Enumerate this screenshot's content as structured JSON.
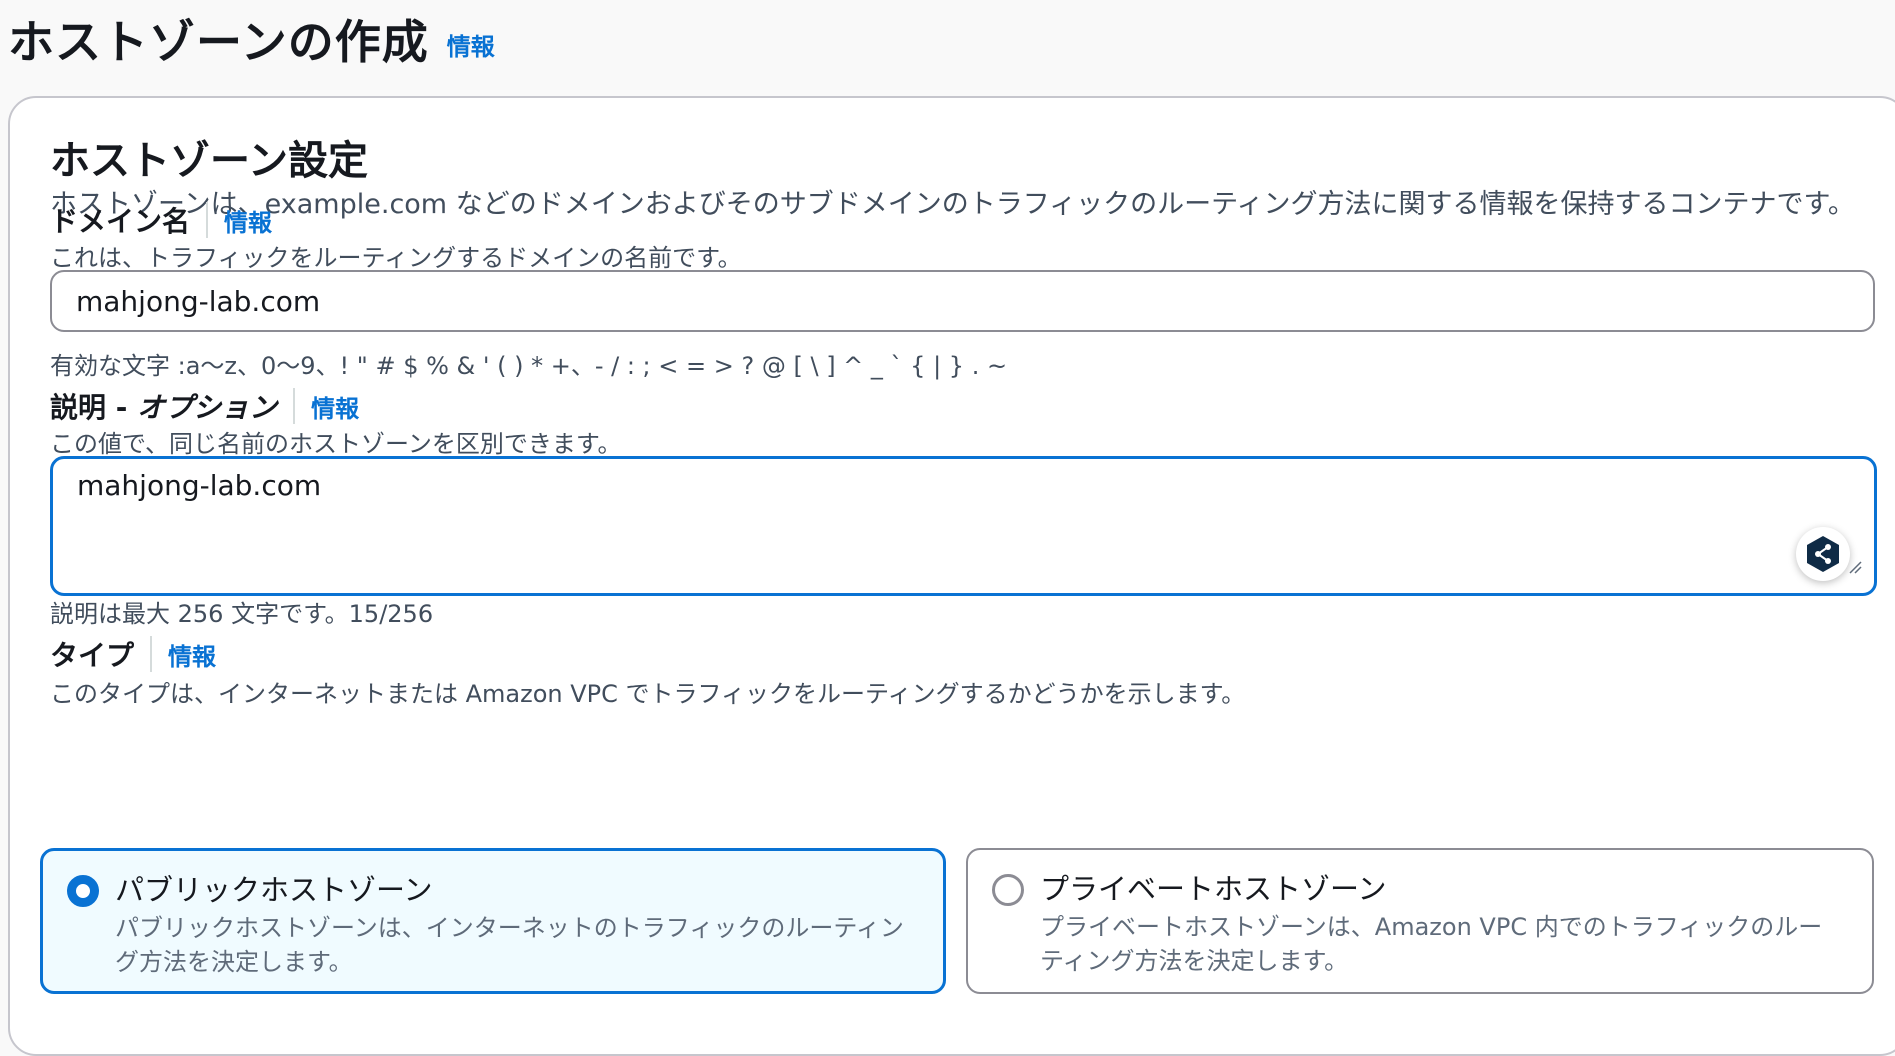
{
  "page": {
    "title": "ホストゾーンの作成",
    "info": "情報"
  },
  "section": {
    "title": "ホストゾーン設定",
    "description": "ホストゾーンは、example.com などのドメインおよびそのサブドメインのトラフィックのルーティング方法に関する情報を保持するコンテナです。"
  },
  "domain": {
    "label": "ドメイン名",
    "info": "情報",
    "description": "これは、トラフィックをルーティングするドメインの名前です。",
    "value": "mahjong-lab.com",
    "constraint": "有効な文字 :a～z、0～9、! \" # $ % & ' ( ) * +、- / : ; < = > ? @ [ \\ ] ^ _ ` { | } . ~"
  },
  "description_field": {
    "label": "説明 - ",
    "label_optional": "オプション",
    "info": "情報",
    "description": "この値で、同じ名前のホストゾーンを区別できます。",
    "value": "mahjong-lab.com",
    "constraint": "説明は最大 256 文字です。15/256"
  },
  "type": {
    "label": "タイプ",
    "info": "情報",
    "description": "このタイプは、インターネットまたは Amazon VPC でトラフィックをルーティングするかどうかを示します。",
    "options": [
      {
        "title": "パブリックホストゾーン",
        "description": "パブリックホストゾーンは、インターネットのトラフィックのルーティング方法を決定します。",
        "selected": true
      },
      {
        "title": "プライベートホストゾーン",
        "description": "プライベートホストゾーンは、Amazon VPC 内でのトラフィックのルーティング方法を決定します。",
        "selected": false
      }
    ]
  },
  "icons": {
    "floating_tool": "deepl-share-icon",
    "resize": "resize-handle-icon"
  },
  "colors": {
    "accent": "#0972d3",
    "selected_bg": "#f0fbff",
    "text": "#16191f",
    "muted": "#414d5c"
  }
}
